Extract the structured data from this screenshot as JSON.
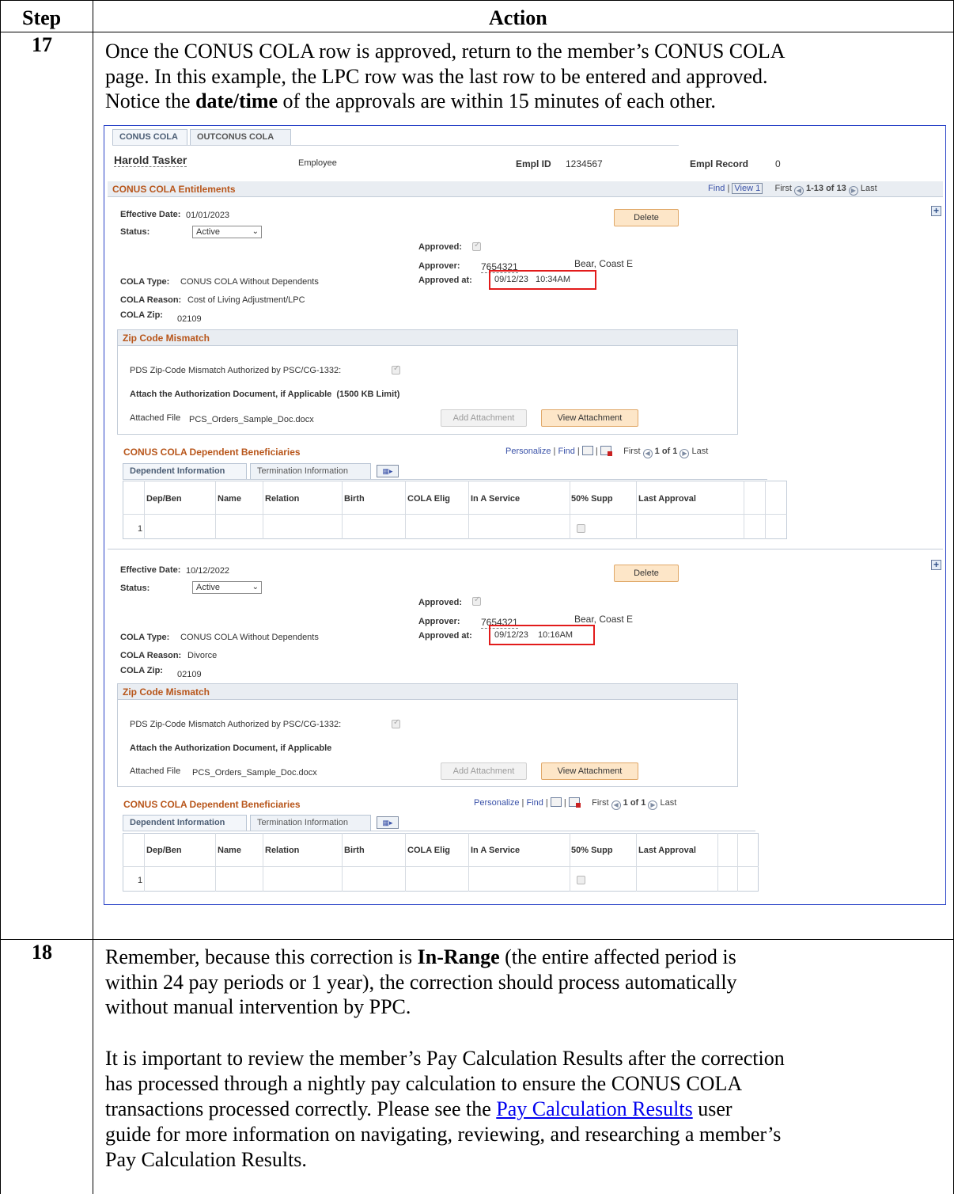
{
  "table": {
    "col_step": "Step",
    "col_action": "Action"
  },
  "step17": {
    "number": "17",
    "line1": "Once the CONUS COLA row is approved, return to the member’s CONUS COLA",
    "line2": "page.  In this example, the LPC row was the last row to be entered and approved.",
    "line3_pre": "Notice the ",
    "line3_bold": "date/time",
    "line3_post": " of the approvals are within 15 minutes of each other."
  },
  "screenshot": {
    "tabs": [
      "CONUS COLA",
      "OUTCONUS COLA"
    ],
    "employee_name": "Harold Tasker",
    "employee_label": "Employee",
    "empl_id_label": "Empl ID",
    "empl_id": "1234567",
    "empl_record_label": "Empl Record",
    "empl_record": "0",
    "entitlements_title": "CONUS COLA Entitlements",
    "nav_find": "Find",
    "nav_view": "View 1",
    "nav_first": "First",
    "nav_range": "1-13 of 13",
    "nav_last": "Last",
    "rows": [
      {
        "effective_date_label": "Effective Date:",
        "effective_date": "01/01/2023",
        "status_label": "Status:",
        "status": "Active",
        "delete": "Delete",
        "approved_label": "Approved:",
        "approver_label": "Approver:",
        "approver_id": "7654321",
        "approver_name": "Bear, Coast E",
        "approved_at_label": "Approved at:",
        "approved_at": "09/12/23   10:34AM",
        "cola_type_label": "COLA Type:",
        "cola_type": "CONUS COLA Without Dependents",
        "cola_reason_label": "COLA Reason:",
        "cola_reason": "Cost of Living Adjustment/LPC",
        "cola_zip_label": "COLA Zip:",
        "cola_zip": "02109",
        "zip_mismatch_title": "Zip Code Mismatch",
        "pds_label": "PDS Zip-Code Mismatch Authorized by PSC/CG-1332:",
        "attach_label": "Attach the Authorization Document, if Applicable",
        "attach_limit": "(1500 KB Limit)",
        "attached_file_label": "Attached File",
        "attached_file": "PCS_Orders_Sample_Doc.docx",
        "add_attachment": "Add Attachment",
        "view_attachment": "View Attachment",
        "dep_title": "CONUS COLA Dependent Beneficiaries",
        "dep_nav_personalize": "Personalize",
        "dep_nav_find": "Find",
        "dep_nav_first": "First",
        "dep_nav_range": "1 of 1",
        "dep_nav_last": "Last",
        "dep_tab1": "Dependent Information",
        "dep_tab2": "Termination Information",
        "dep_cols": [
          "Dep/Ben",
          "Name",
          "Relation",
          "Birth",
          "COLA Elig",
          "In A Service",
          "50% Supp",
          "Last Approval"
        ],
        "dep_row_num": "1"
      },
      {
        "effective_date_label": "Effective Date:",
        "effective_date": "10/12/2022",
        "status_label": "Status:",
        "status": "Active",
        "delete": "Delete",
        "approved_label": "Approved:",
        "approver_label": "Approver:",
        "approver_id": "7654321",
        "approver_name": "Bear, Coast E",
        "approved_at_label": "Approved at:",
        "approved_at": "09/12/23    10:16AM",
        "cola_type_label": "COLA Type:",
        "cola_type": "CONUS COLA Without Dependents",
        "cola_reason_label": "COLA Reason:",
        "cola_reason": "Divorce",
        "cola_zip_label": "COLA Zip:",
        "cola_zip": "02109",
        "zip_mismatch_title": "Zip Code Mismatch",
        "pds_label": "PDS Zip-Code Mismatch Authorized by PSC/CG-1332:",
        "attach_label": "Attach the Authorization Document, if Applicable",
        "attach_limit": "",
        "attached_file_label": "Attached File",
        "attached_file": "PCS_Orders_Sample_Doc.docx",
        "add_attachment": "Add Attachment",
        "view_attachment": "View Attachment",
        "dep_title": "CONUS COLA Dependent Beneficiaries",
        "dep_nav_personalize": "Personalize",
        "dep_nav_find": "Find",
        "dep_nav_first": "First",
        "dep_nav_range": "1 of 1",
        "dep_nav_last": "Last",
        "dep_tab1": "Dependent Information",
        "dep_tab2": "Termination Information",
        "dep_cols": [
          "Dep/Ben",
          "Name",
          "Relation",
          "Birth",
          "COLA Elig",
          "In A Service",
          "50% Supp",
          "Last Approval"
        ],
        "dep_row_num": "1"
      }
    ]
  },
  "step18": {
    "number": "18",
    "p1_line1_pre": "Remember, because this correction is ",
    "p1_line1_bold": "In-Range",
    "p1_line1_post": " (the entire affected period is",
    "p1_line2": "within 24 pay periods or 1 year), the correction should process automatically",
    "p1_line3": "without manual intervention by PPC.",
    "p2_line1": "It is important to review the member’s Pay Calculation Results after the correction",
    "p2_line2": "has processed through a nightly pay calculation to ensure the CONUS COLA",
    "p2_line3_pre": "transactions processed correctly.  Please see the ",
    "p2_line3_link": "Pay Calculation Results",
    "p2_line3_post": " user",
    "p2_line4": "guide for more information on navigating, reviewing, and researching a member’s",
    "p2_line5": "Pay Calculation Results."
  }
}
